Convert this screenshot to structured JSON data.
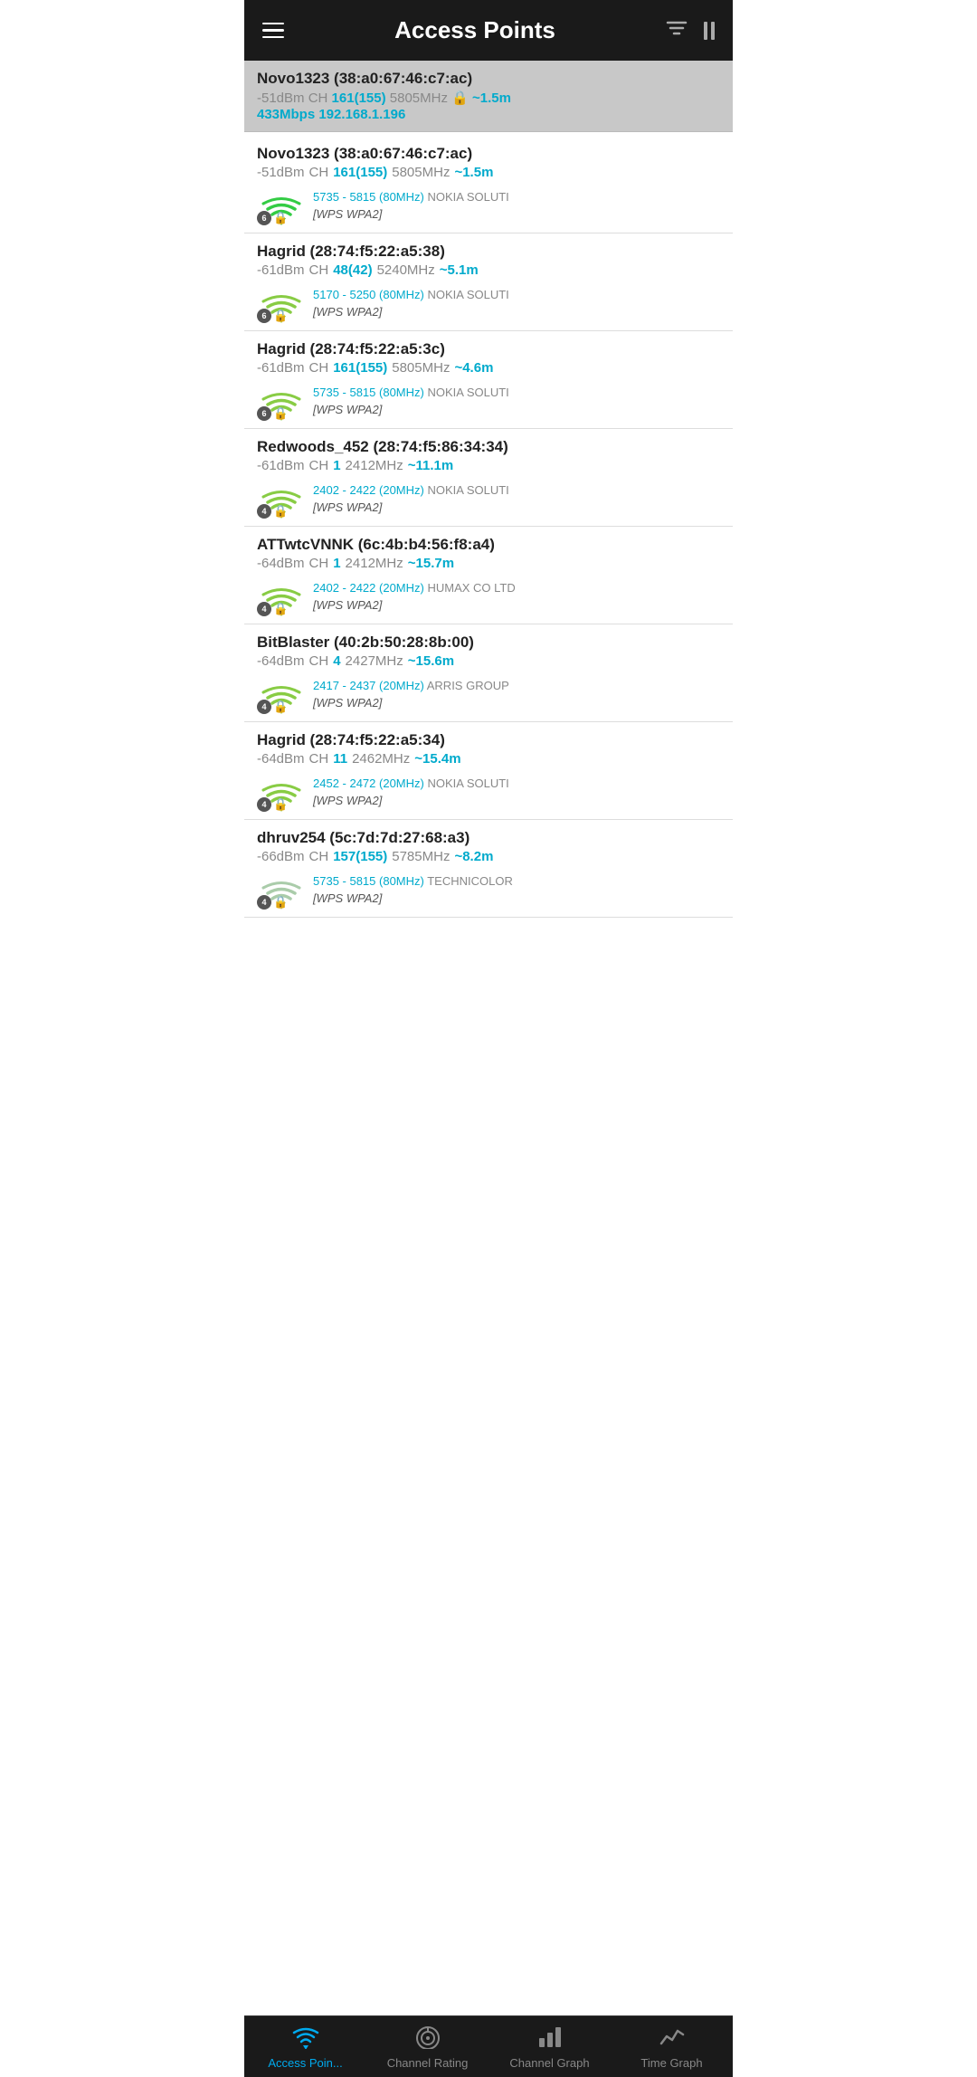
{
  "header": {
    "title": "Access Points",
    "filter_label": "filter",
    "pause_label": "pause"
  },
  "selected_item": {
    "name": "Novo1323 (38:a0:67:46:c7:ac)",
    "signal": "-51dBm",
    "channel_label": "CH",
    "channel": "161(155)",
    "freq": "5805MHz",
    "distance": "~1.5m",
    "speed": "433Mbps",
    "ip": "192.168.1.196"
  },
  "access_points": [
    {
      "name": "Novo1323 (38:a0:67:46:c7:ac)",
      "signal": "-51dBm",
      "channel": "161(155)",
      "freq": "5805MHz",
      "distance": "~1.5m",
      "badge": "6",
      "freq_range": "5735 - 5815 (80MHz)",
      "vendor": "NOKIA SOLUTI",
      "security": "[WPS WPA2]"
    },
    {
      "name": "Hagrid (28:74:f5:22:a5:38)",
      "signal": "-61dBm",
      "channel": "48(42)",
      "freq": "5240MHz",
      "distance": "~5.1m",
      "badge": "6",
      "freq_range": "5170 - 5250 (80MHz)",
      "vendor": "NOKIA SOLUTI",
      "security": "[WPS WPA2]"
    },
    {
      "name": "Hagrid (28:74:f5:22:a5:3c)",
      "signal": "-61dBm",
      "channel": "161(155)",
      "freq": "5805MHz",
      "distance": "~4.6m",
      "badge": "6",
      "freq_range": "5735 - 5815 (80MHz)",
      "vendor": "NOKIA SOLUTI",
      "security": "[WPS WPA2]"
    },
    {
      "name": "Redwoods_452 (28:74:f5:86:34:34)",
      "signal": "-61dBm",
      "channel": "1",
      "freq": "2412MHz",
      "distance": "~11.1m",
      "badge": "4",
      "freq_range": "2402 - 2422 (20MHz)",
      "vendor": "NOKIA SOLUTI",
      "security": "[WPS WPA2]"
    },
    {
      "name": "ATTwtcVNNK (6c:4b:b4:56:f8:a4)",
      "signal": "-64dBm",
      "channel": "1",
      "freq": "2412MHz",
      "distance": "~15.7m",
      "badge": "4",
      "freq_range": "2402 - 2422 (20MHz)",
      "vendor": "HUMAX CO LTD",
      "security": "[WPS WPA2]"
    },
    {
      "name": "BitBlaster (40:2b:50:28:8b:00)",
      "signal": "-64dBm",
      "channel": "4",
      "freq": "2427MHz",
      "distance": "~15.6m",
      "badge": "4",
      "freq_range": "2417 - 2437 (20MHz)",
      "vendor": "ARRIS GROUP",
      "security": "[WPS WPA2]"
    },
    {
      "name": "Hagrid (28:74:f5:22:a5:34)",
      "signal": "-64dBm",
      "channel": "11",
      "freq": "2462MHz",
      "distance": "~15.4m",
      "badge": "4",
      "freq_range": "2452 - 2472 (20MHz)",
      "vendor": "NOKIA SOLUTI",
      "security": "[WPS WPA2]"
    },
    {
      "name": "dhruv254 (5c:7d:7d:27:68:a3)",
      "signal": "-66dBm",
      "channel": "157(155)",
      "freq": "5785MHz",
      "distance": "~8.2m",
      "badge": "4",
      "freq_range": "5735 - 5815 (80MHz)",
      "vendor": "TECHNICOLOR",
      "security": "[WPS WPA2]"
    }
  ],
  "bottom_nav": {
    "items": [
      {
        "id": "access-points",
        "label": "Access Poin...",
        "active": true,
        "icon": "wifi"
      },
      {
        "id": "channel-rating",
        "label": "Channel Rating",
        "active": false,
        "icon": "signal"
      },
      {
        "id": "channel-graph",
        "label": "Channel Graph",
        "active": false,
        "icon": "bar-chart"
      },
      {
        "id": "time-graph",
        "label": "Time Graph",
        "active": false,
        "icon": "line-chart"
      }
    ]
  }
}
